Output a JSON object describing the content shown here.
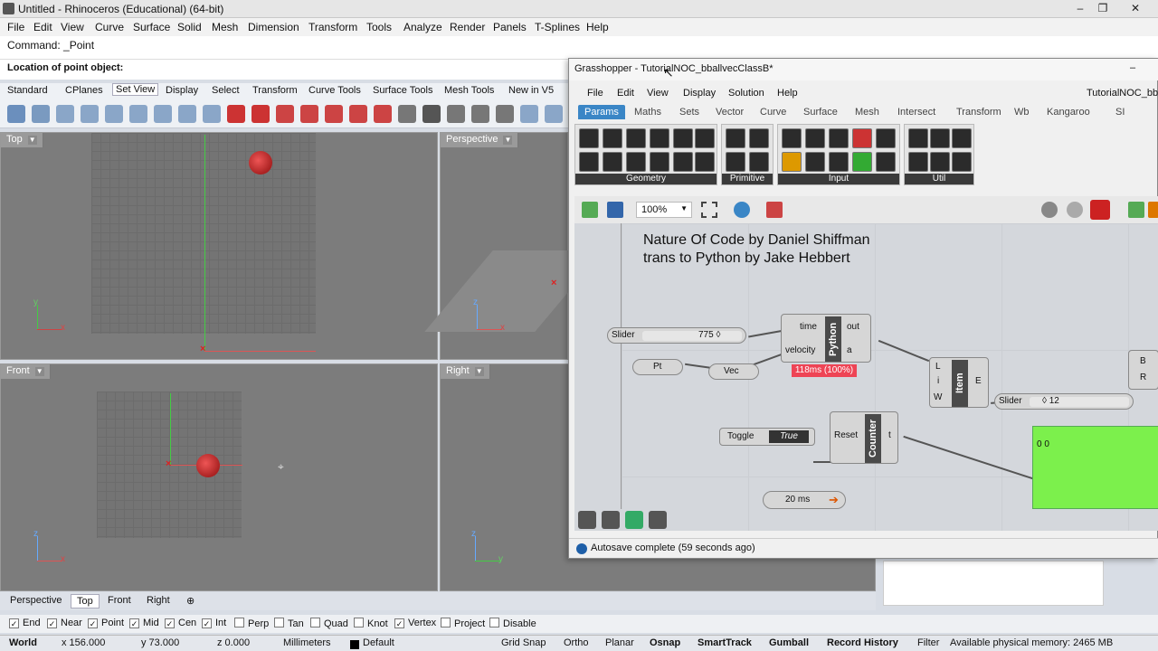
{
  "rhino": {
    "title": "Untitled - Rhinoceros (Educational) (64-bit)",
    "window_controls": [
      "–",
      "❐",
      "✕"
    ],
    "menu": [
      "File",
      "Edit",
      "View",
      "Curve",
      "Surface",
      "Solid",
      "Mesh",
      "Dimension",
      "Transform",
      "Tools",
      "Analyze",
      "Render",
      "Panels",
      "T-Splines",
      "Help"
    ],
    "command_history": "Command: _Point",
    "command_prompt": "Location of point object:",
    "toolbar_tabs": [
      "Standard",
      "CPlanes",
      "Set View",
      "Display",
      "Select",
      "Transform",
      "Curve Tools",
      "Surface Tools",
      "Mesh Tools",
      "New in V5"
    ],
    "active_toolbar_tab": "Set View",
    "viewports": {
      "top": "Top",
      "perspective": "Perspective",
      "front": "Front",
      "right": "Right"
    },
    "axis": {
      "x": "x",
      "y": "y",
      "z": "z"
    },
    "viewport_tabs": [
      "Perspective",
      "Top",
      "Front",
      "Right"
    ],
    "active_viewport_tab": "Top",
    "add_tab": "⊕",
    "osnaps": [
      {
        "label": "End",
        "checked": true
      },
      {
        "label": "Near",
        "checked": true
      },
      {
        "label": "Point",
        "checked": true
      },
      {
        "label": "Mid",
        "checked": true
      },
      {
        "label": "Cen",
        "checked": true
      },
      {
        "label": "Int",
        "checked": true
      },
      {
        "label": "Perp",
        "checked": false
      },
      {
        "label": "Tan",
        "checked": false
      },
      {
        "label": "Quad",
        "checked": false
      },
      {
        "label": "Knot",
        "checked": false
      },
      {
        "label": "Vertex",
        "checked": true
      },
      {
        "label": "Project",
        "checked": false
      },
      {
        "label": "Disable",
        "checked": false
      }
    ],
    "status": {
      "cplane": "World",
      "x": "x 156.000",
      "y": "y 73.000",
      "z": "z 0.000",
      "units": "Millimeters",
      "layer": "Default",
      "toggles": [
        "Grid Snap",
        "Ortho",
        "Planar",
        "Osnap",
        "SmartTrack",
        "Gumball",
        "Record History",
        "Filter"
      ],
      "memory": "Available physical memory: 2465 MB"
    }
  },
  "grasshopper": {
    "title": "Grasshopper - TutorialNOC_bballvecClassB*",
    "menu": [
      "File",
      "Edit",
      "View",
      "Display",
      "Solution",
      "Help"
    ],
    "doc_name": "TutorialNOC_bball",
    "tabs": [
      "Params",
      "Maths",
      "Sets",
      "Vector",
      "Curve",
      "Surface",
      "Mesh",
      "Intersect",
      "Transform",
      "Wb",
      "Kangaroo",
      "SI"
    ],
    "active_tab": "Params",
    "ribbon_groups": [
      "Geometry",
      "Primitive",
      "Input",
      "Util"
    ],
    "zoom": "100%",
    "note_line1": "Nature Of Code by Daniel Shiffman",
    "note_line2": "trans to Python by Jake Hebbert",
    "slider1": {
      "label": "Slider",
      "value": "775 ◊"
    },
    "pt": "Pt",
    "vec": "Vec",
    "python": {
      "title": "Python",
      "inputs": [
        "time",
        "velocity"
      ],
      "outputs": [
        "out",
        "a"
      ],
      "timing": "118ms (100%)"
    },
    "item": {
      "title": "Item",
      "inputs": [
        "L",
        "i",
        "W"
      ],
      "output": "E"
    },
    "slider2": {
      "label": "Slider",
      "value": "◊ 12"
    },
    "toggle": {
      "label": "Toggle",
      "value": "True"
    },
    "counter": {
      "title": "Counter",
      "input": "Reset",
      "output": "t"
    },
    "timer": "20 ms",
    "panel_value": "0 0",
    "right_inputs": [
      "B",
      "R"
    ],
    "status": "Autosave complete (59 seconds ago)"
  }
}
